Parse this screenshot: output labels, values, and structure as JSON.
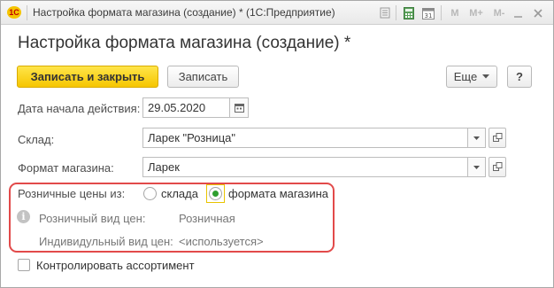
{
  "window": {
    "title": "Настройка формата магазина (создание) * (1С:Предприятие)",
    "logo_text": "1С",
    "toolbar_m": "M",
    "toolbar_m_plus": "M+",
    "toolbar_m_minus": "M-",
    "calendar_day": "31"
  },
  "form": {
    "title": "Настройка формата магазина (создание) *"
  },
  "toolbar": {
    "save_close_label": "Записать и закрыть",
    "save_label": "Записать",
    "more_label": "Еще",
    "help_label": "?"
  },
  "fields": {
    "start_date": {
      "label": "Дата начала действия:",
      "value": "29.05.2020"
    },
    "warehouse": {
      "label": "Склад:",
      "value": "Ларек \"Розница\""
    },
    "store_format": {
      "label": "Формат магазина:",
      "value": "Ларек"
    }
  },
  "retail_prices": {
    "label": "Розничные цены из:",
    "options": [
      {
        "label": "склада",
        "selected": false
      },
      {
        "label": "формата магазина",
        "selected": true
      }
    ],
    "retail_price_type_label": "Розничный вид цен:",
    "retail_price_type_value": "Розничная",
    "individual_price_type_label": "Индивидульный вид цен:",
    "individual_price_type_value": "<используется>"
  },
  "control_assortment": {
    "label": "Контролировать ассортимент",
    "checked": false
  },
  "colors": {
    "primary_button": "#f6c600",
    "highlight_border": "#e24a4a",
    "radio_selected": "#2e9f2e"
  }
}
